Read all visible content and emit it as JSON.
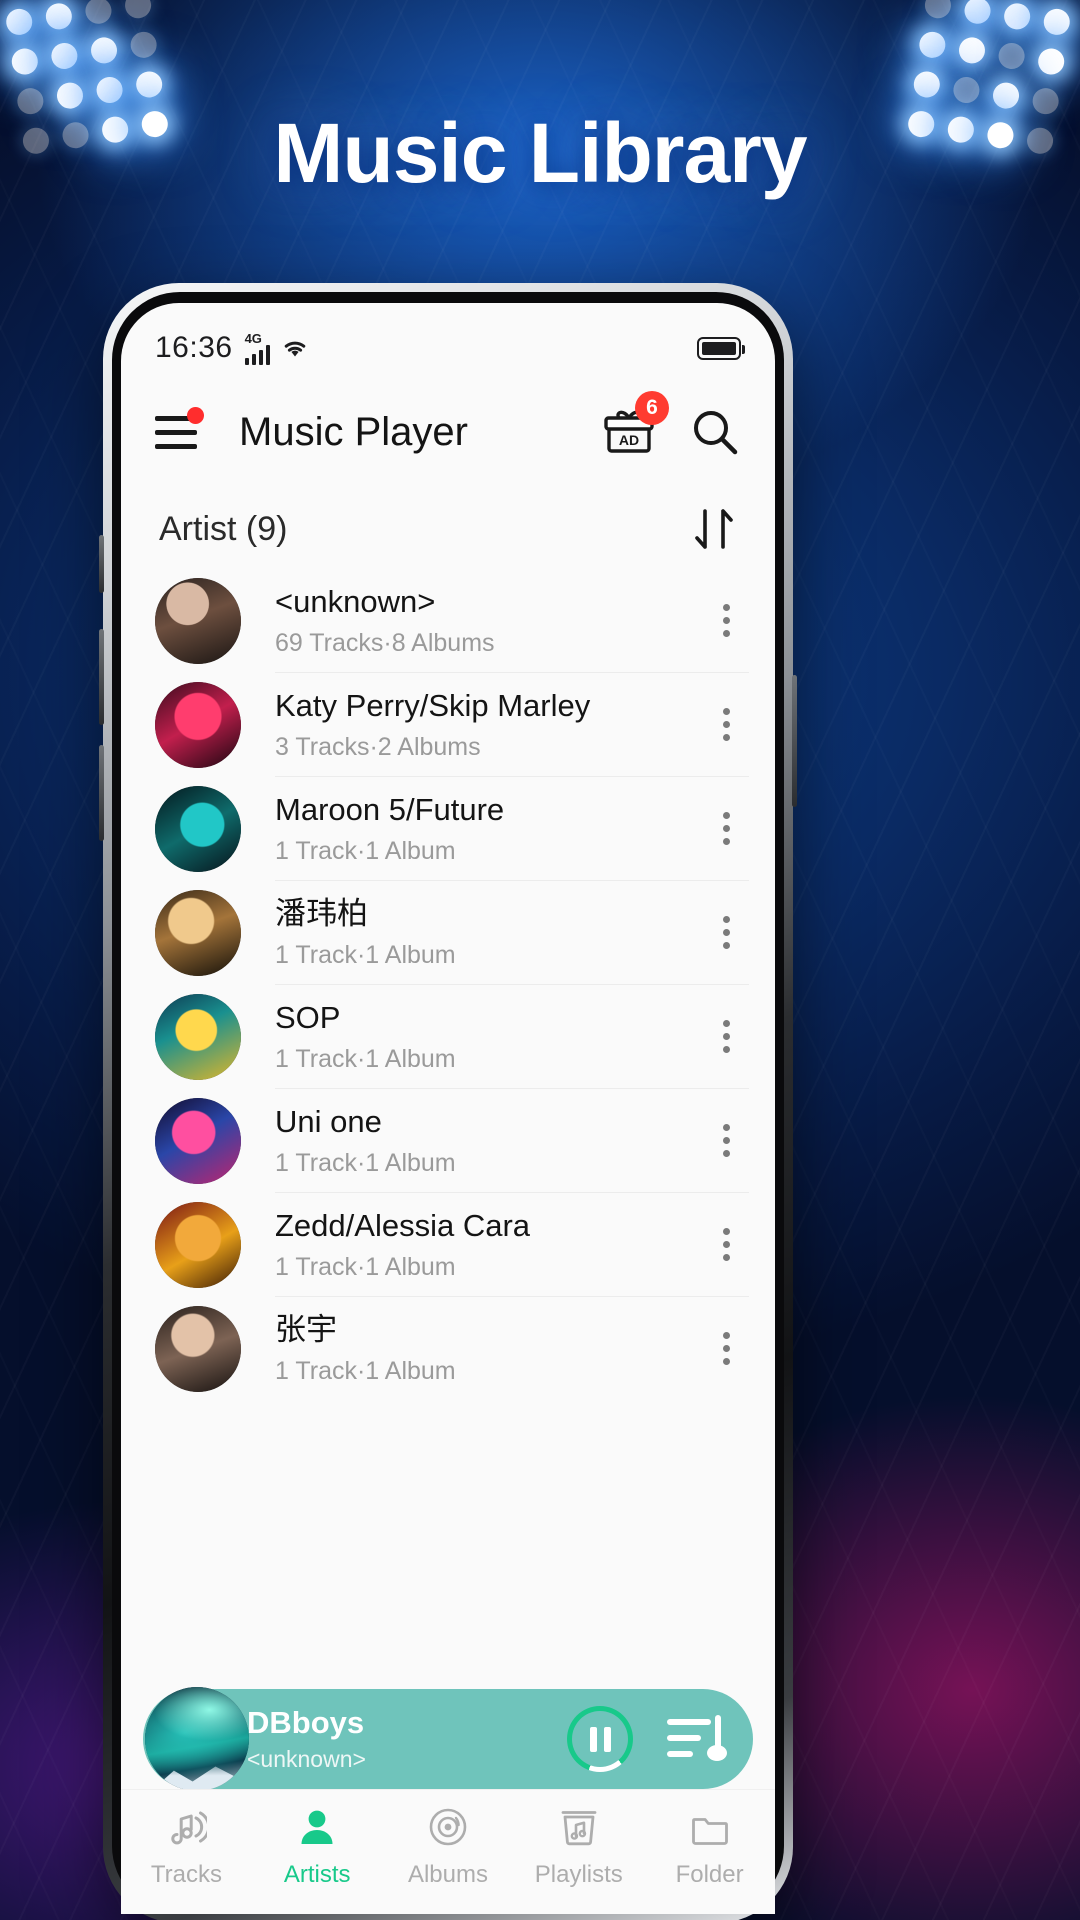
{
  "promo": {
    "title": "Music Library"
  },
  "status_bar": {
    "time": "16:36",
    "network_label": "4G",
    "signal_icon": "signal-bars-icon",
    "wifi_icon": "wifi-icon",
    "battery_icon": "battery-full-icon"
  },
  "app_bar": {
    "title": "Music Player",
    "menu_icon": "hamburger-menu-icon",
    "menu_has_badge": true,
    "gift_icon": "gift-ad-icon",
    "gift_label": "AD",
    "gift_badge_count": "6",
    "search_icon": "search-icon"
  },
  "list_header": {
    "title": "Artist (9)",
    "sort_icon": "sort-arrows-icon"
  },
  "artists": [
    {
      "name": "<unknown>",
      "meta": "69 Tracks·8 Albums",
      "more_icon": "more-vertical-icon"
    },
    {
      "name": "Katy Perry/Skip Marley",
      "meta": "3 Tracks·2 Albums",
      "more_icon": "more-vertical-icon"
    },
    {
      "name": "Maroon 5/Future",
      "meta": "1 Track·1 Album",
      "more_icon": "more-vertical-icon"
    },
    {
      "name": "潘玮柏",
      "meta": "1 Track·1 Album",
      "more_icon": "more-vertical-icon"
    },
    {
      "name": "SOP",
      "meta": "1 Track·1 Album",
      "more_icon": "more-vertical-icon"
    },
    {
      "name": "Uni one",
      "meta": "1 Track·1 Album",
      "more_icon": "more-vertical-icon"
    },
    {
      "name": "Zedd/Alessia Cara",
      "meta": "1 Track·1 Album",
      "more_icon": "more-vertical-icon"
    },
    {
      "name": "张宇",
      "meta": "1 Track·1 Album",
      "more_icon": "more-vertical-icon"
    }
  ],
  "now_playing": {
    "title": "DBboys",
    "artist": "<unknown>",
    "play_state_icon": "pause-icon",
    "queue_icon": "playlist-queue-icon",
    "progress_percent": 83,
    "bar_color": "#6fc4bb",
    "progress_color": "#18c98a"
  },
  "bottom_nav": {
    "active": "Artists",
    "items": [
      {
        "label": "Tracks",
        "icon": "music-note-waves-icon"
      },
      {
        "label": "Artists",
        "icon": "person-icon"
      },
      {
        "label": "Albums",
        "icon": "vinyl-disc-icon"
      },
      {
        "label": "Playlists",
        "icon": "playlist-box-icon"
      },
      {
        "label": "Folder",
        "icon": "folder-icon"
      }
    ]
  },
  "theme": {
    "accent": "#18c98a",
    "badge_red": "#ff3b30",
    "nav_inactive": "#adadad"
  }
}
